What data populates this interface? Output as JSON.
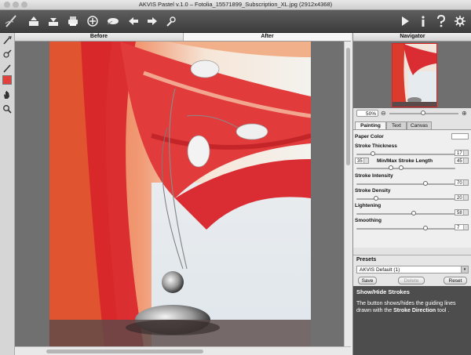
{
  "window": {
    "title": "AKVIS Pastel v.1.0 – Fotolia_15571899_Subscription_XL.jpg (2912x4368)"
  },
  "toolbar": {
    "left_icons": [
      "akvis-logo-icon",
      "open-icon",
      "save-icon",
      "print-icon",
      "share-icon",
      "batch-icon",
      "undo-icon",
      "redo-icon",
      "run-icon"
    ],
    "right_icons": [
      "play-icon",
      "info-icon",
      "help-icon",
      "settings-icon"
    ]
  },
  "tools": [
    "direction-tool-icon",
    "eraser-tool-icon",
    "brush-tool-icon",
    "color-swatch",
    "hand-tool-icon",
    "zoom-tool-icon"
  ],
  "tool_color": "#e0413a",
  "view_tabs": {
    "before": "Before",
    "after": "After"
  },
  "navigator": {
    "title": "Navigator",
    "zoom": "50%"
  },
  "settings_tabs": {
    "painting": "Painting",
    "text": "Text",
    "canvas": "Canvas"
  },
  "params": {
    "paper_color": "Paper Color",
    "stroke_thickness": {
      "label": "Stroke Thickness",
      "value": "17",
      "level": 0.17
    },
    "stroke_length": {
      "label": "Min/Max Stroke Length",
      "min": "35",
      "max": "45",
      "min_level": 0.35,
      "max_level": 0.45
    },
    "stroke_intensity": {
      "label": "Stroke Intensity",
      "value": "70",
      "level": 0.7
    },
    "stroke_density": {
      "label": "Stroke Density",
      "value": "20",
      "level": 0.2
    },
    "lightening": {
      "label": "Lightening",
      "value": "58",
      "level": 0.58
    },
    "smoothing": {
      "label": "Smoothing",
      "value": "7",
      "level": 0.7
    }
  },
  "presets": {
    "title": "Presets",
    "selected": "AKVIS Default (1)",
    "save": "Save",
    "delete": "Delete",
    "reset": "Reset"
  },
  "help": {
    "title": "Show/Hide Strokes",
    "text_before": "The button shows/hides the guiding lines drawn with the ",
    "text_bold": "Stroke Direction",
    "text_after": " tool ."
  }
}
